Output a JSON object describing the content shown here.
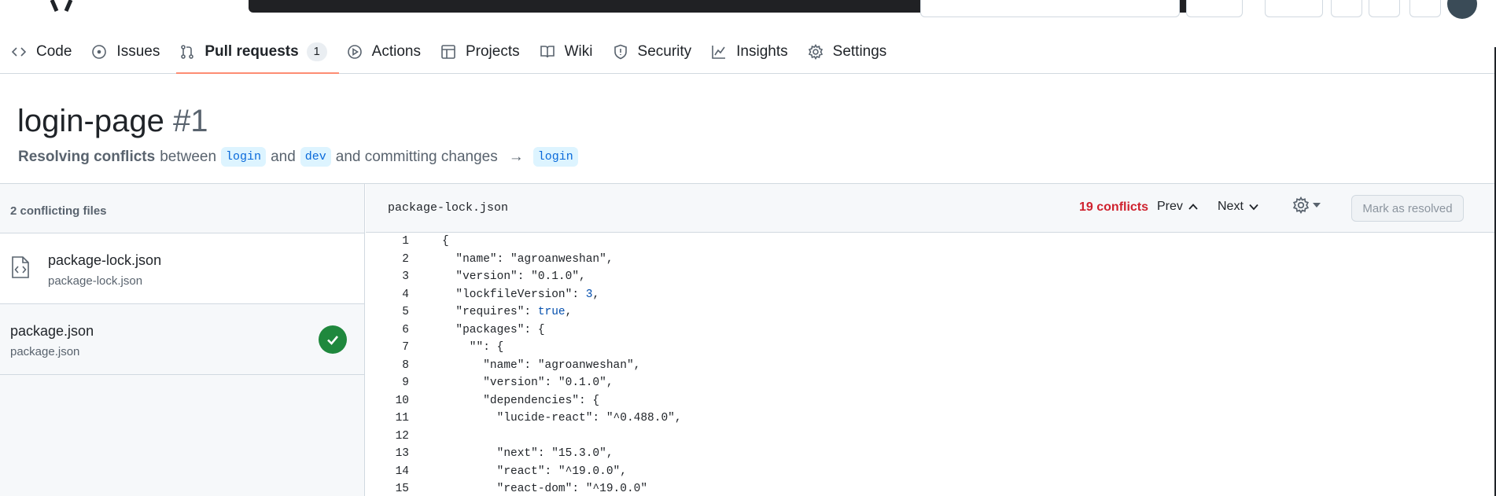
{
  "nav": {
    "items": [
      {
        "label": "Code",
        "icon": "code-icon"
      },
      {
        "label": "Issues",
        "icon": "issue-opened-icon"
      },
      {
        "label": "Pull requests",
        "icon": "git-pull-request-icon",
        "count": "1",
        "active": true
      },
      {
        "label": "Actions",
        "icon": "play-icon"
      },
      {
        "label": "Projects",
        "icon": "table-icon"
      },
      {
        "label": "Wiki",
        "icon": "book-icon"
      },
      {
        "label": "Security",
        "icon": "shield-icon"
      },
      {
        "label": "Insights",
        "icon": "graph-icon"
      },
      {
        "label": "Settings",
        "icon": "gear-icon"
      }
    ]
  },
  "header": {
    "title": "login-page",
    "number": "#1",
    "subtitle_bold": "Resolving conflicts",
    "between": "between",
    "base_branch": "login",
    "and": "and",
    "head_branch": "dev",
    "committing": "and committing changes",
    "target_branch": "login"
  },
  "sidebar": {
    "heading": "2 conflicting files",
    "files": [
      {
        "name": "package-lock.json",
        "path": "package-lock.json",
        "resolved": false
      },
      {
        "name": "package.json",
        "path": "package.json",
        "resolved": true
      }
    ]
  },
  "editor": {
    "filename": "package-lock.json",
    "conflicts_label": "19 conflicts",
    "prev_label": "Prev",
    "next_label": "Next",
    "resolve_label": "Mark as resolved",
    "lines": [
      {
        "n": "1",
        "text": "{"
      },
      {
        "n": "2",
        "text": "  \"name\": \"agroanweshan\","
      },
      {
        "n": "3",
        "text": "  \"version\": \"0.1.0\","
      },
      {
        "n": "4",
        "text": "  \"lockfileVersion\": 3,"
      },
      {
        "n": "5",
        "text": "  \"requires\": true,"
      },
      {
        "n": "6",
        "text": "  \"packages\": {"
      },
      {
        "n": "7",
        "text": "    \"\": {"
      },
      {
        "n": "8",
        "text": "      \"name\": \"agroanweshan\","
      },
      {
        "n": "9",
        "text": "      \"version\": \"0.1.0\","
      },
      {
        "n": "10",
        "text": "      \"dependencies\": {"
      },
      {
        "n": "11",
        "text": "        \"lucide-react\": \"^0.488.0\","
      },
      {
        "n": "12",
        "text": ""
      },
      {
        "n": "13",
        "text": "        \"next\": \"15.3.0\","
      },
      {
        "n": "14",
        "text": "        \"react\": \"^19.0.0\","
      },
      {
        "n": "15",
        "text": "        \"react-dom\": \"^19.0.0\""
      }
    ]
  },
  "colors": {
    "accent_underline": "#fd8c73",
    "conflict_red": "#cf222e",
    "resolved_green": "#1f883d",
    "branch_bg": "#ddf4ff",
    "branch_text": "#0969da"
  }
}
